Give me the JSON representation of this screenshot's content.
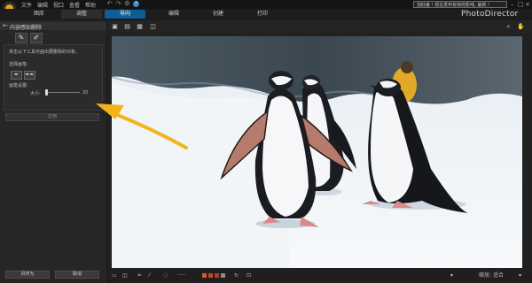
{
  "menu": {
    "items": [
      "文件",
      "编辑",
      "视口",
      "查看",
      "帮助"
    ]
  },
  "promo_text": "加好差 ! 现在发布有效的影响, 最新 !",
  "tabs": {
    "library": "图库",
    "adjust": "调整",
    "guided": "导向",
    "edit": "编辑",
    "create": "创建",
    "print": "打印"
  },
  "brand": "PhotoDirector",
  "panel": {
    "title": "内容感知删除",
    "instruction": "单击以下工具可画出要删除的对象。",
    "select_brush_label": "选择画笔:",
    "brush_settings_label": "画笔设置:",
    "size_label": "大小:",
    "size_value": "20",
    "apply_label": "应用",
    "save_as_label": "另存为",
    "cancel_label": "取消"
  },
  "bottom_bar": {
    "fit_label": "缩放:",
    "fit_value": "适合"
  },
  "colors": {
    "accent": "#0e5e93",
    "logo": "#e9a614",
    "annotation_arrow": "#f2b31b"
  }
}
